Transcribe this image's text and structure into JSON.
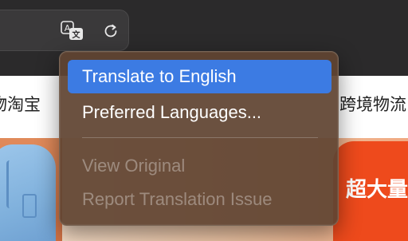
{
  "toolbar": {
    "translate_icon": "translate-icon",
    "translate_glyph_source": "A",
    "translate_glyph_target": "文",
    "reload_icon": "reload-icon"
  },
  "page": {
    "nav_left_text": "物淘宝",
    "nav_right_text": "跨境物流",
    "promo_text": "超大量"
  },
  "menu": {
    "items": [
      {
        "label": "Translate to English",
        "state": "highlighted"
      },
      {
        "label": "Preferred Languages...",
        "state": "enabled"
      },
      {
        "label": "View Original",
        "state": "disabled"
      },
      {
        "label": "Report Translation Issue",
        "state": "disabled"
      }
    ]
  },
  "colors": {
    "toolbar_bg": "#2b2a2b",
    "menu_bg": "#604432",
    "highlight": "#3c7be3",
    "promo": "#ee4a1c"
  }
}
